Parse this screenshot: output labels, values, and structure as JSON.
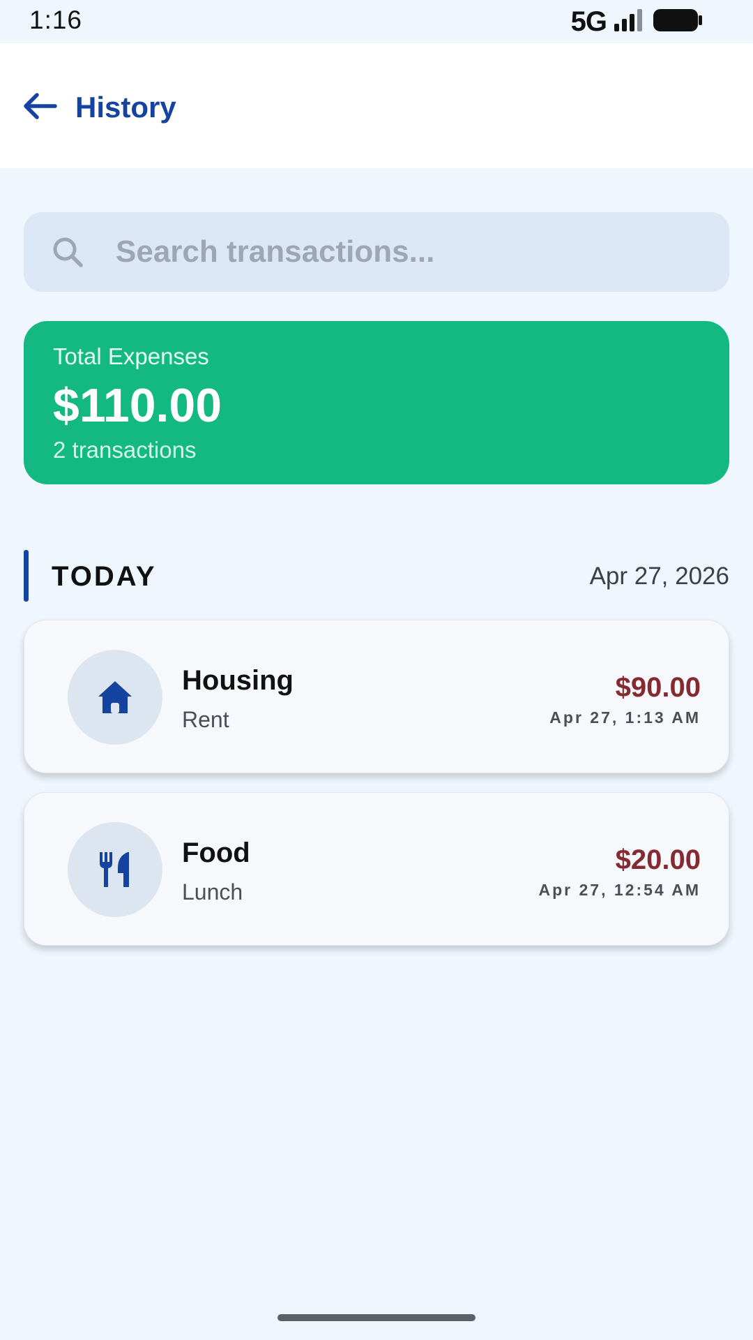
{
  "status_bar": {
    "time": "1:16",
    "network": "5G",
    "signal_icon": "signal-icon",
    "battery_icon": "battery-icon"
  },
  "header": {
    "back_icon": "arrow-left-icon",
    "title": "History"
  },
  "search": {
    "icon": "search-icon",
    "placeholder": "Search transactions..."
  },
  "summary": {
    "label": "Total Expenses",
    "total": "$110.00",
    "count": "2 transactions",
    "color": "#13b981"
  },
  "section": {
    "title": "TODAY",
    "date": "Apr 27, 2026"
  },
  "transactions": [
    {
      "icon": "house-icon",
      "category": "Housing",
      "note": "Rent",
      "amount": "$90.00",
      "time": "Apr 27, 1:13 AM"
    },
    {
      "icon": "utensils-icon",
      "category": "Food",
      "note": "Lunch",
      "amount": "$20.00",
      "time": "Apr 27, 12:54 AM"
    }
  ],
  "colors": {
    "accent": "#1543a0",
    "expense": "#842a30",
    "background": "#eff6fd"
  }
}
